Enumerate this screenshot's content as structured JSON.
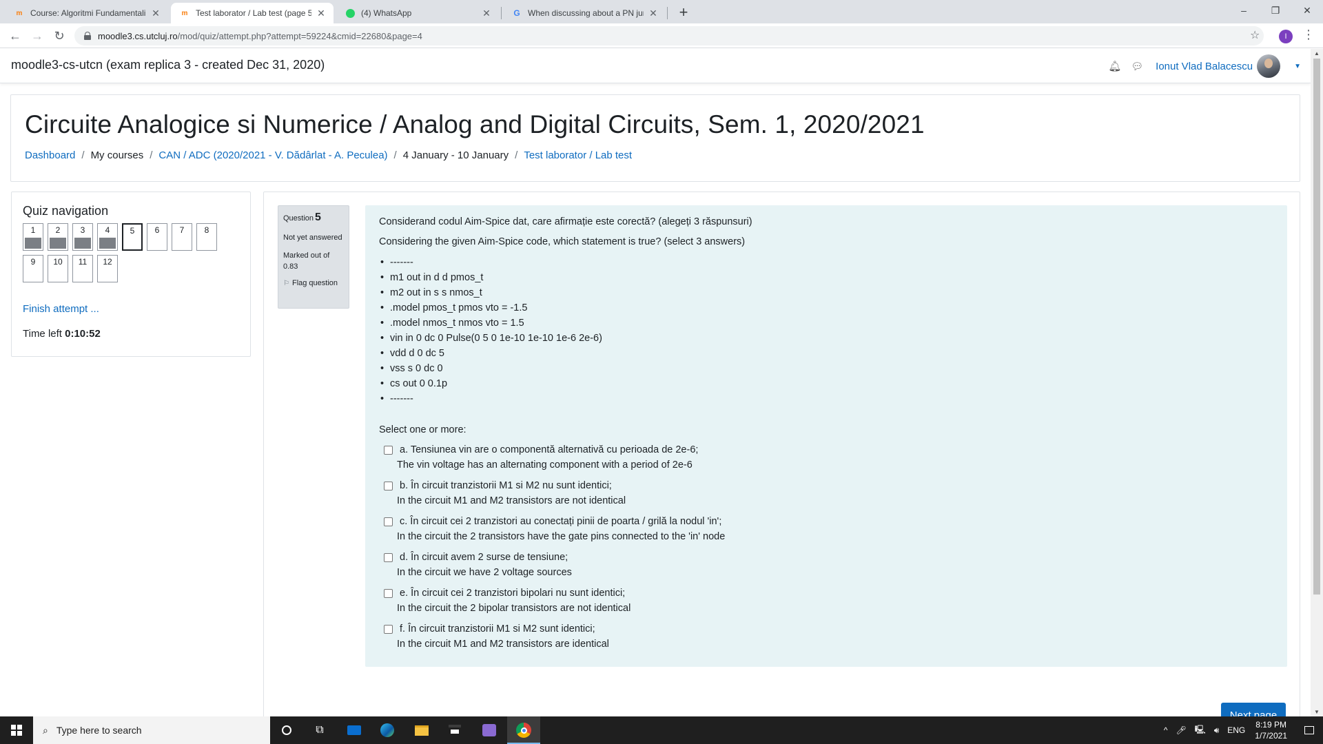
{
  "browser": {
    "tabs": [
      {
        "title": "Course: Algoritmi Fundamentali",
        "favicon": "moodle-icon",
        "active": false
      },
      {
        "title": "Test laborator / Lab test (page 5",
        "favicon": "moodle-icon",
        "active": true
      },
      {
        "title": "(4) WhatsApp",
        "favicon": "whatsapp-icon",
        "active": false
      },
      {
        "title": "When discussing about a PN junc",
        "favicon": "google-icon",
        "active": false
      }
    ],
    "url_host": "moodle3.cs.utcluj.ro",
    "url_path": "/mod/quiz/attempt.php?attempt=59224&cmid=22680&page=4",
    "profile_initial": "I"
  },
  "navbar": {
    "site_name": "moodle3-cs-utcn (exam replica 3 - created Dec 31, 2020)",
    "user_name": "Ionut Vlad Balacescu"
  },
  "header": {
    "course_title": "Circuite Analogice si Numerice / Analog and Digital Circuits, Sem. 1, 2020/2021",
    "breadcrumb": [
      {
        "label": "Dashboard",
        "link": true
      },
      {
        "label": "My courses",
        "link": false
      },
      {
        "label": "CAN / ADC (2020/2021 - V. Dădârlat - A. Peculea)",
        "link": true
      },
      {
        "label": "4 January - 10 January",
        "link": false
      },
      {
        "label": "Test laborator / Lab test",
        "link": true
      }
    ]
  },
  "quiz_nav": {
    "title": "Quiz navigation",
    "questions": [
      {
        "n": "1",
        "answered": true
      },
      {
        "n": "2",
        "answered": true
      },
      {
        "n": "3",
        "answered": true
      },
      {
        "n": "4",
        "answered": true
      },
      {
        "n": "5",
        "answered": false,
        "current": true
      },
      {
        "n": "6",
        "answered": false
      },
      {
        "n": "7",
        "answered": false
      },
      {
        "n": "8",
        "answered": false
      },
      {
        "n": "9",
        "answered": false
      },
      {
        "n": "10",
        "answered": false
      },
      {
        "n": "11",
        "answered": false
      },
      {
        "n": "12",
        "answered": false
      }
    ],
    "finish_label": "Finish attempt ...",
    "time_left_label": "Time left",
    "time_left_value": "0:10:52"
  },
  "question": {
    "label": "Question",
    "number": "5",
    "state": "Not yet answered",
    "grade": "Marked out of 0.83",
    "flag_label": "Flag question",
    "text_ro": "Considerand codul Aim-Spice dat, care afirmație este corectă? (alegeți 3 răspunsuri)",
    "text_en": "Considering the given Aim-Spice code, which statement is true? (select 3 answers)",
    "code_lines": [
      "-------",
      "m1 out in d d pmos_t",
      "m2 out in s s nmos_t",
      ".model pmos_t pmos vto = -1.5",
      ".model nmos_t nmos vto = 1.5",
      "vin in 0 dc 0 Pulse(0 5 0 1e-10 1e-10 1e-6 2e-6)",
      "vdd d 0 dc 5",
      "vss s 0 dc 0",
      "cs out 0 0.1p",
      "-------"
    ],
    "prompt": "Select one or more:",
    "options": [
      {
        "ro": "a. Tensiunea vin are o componentă alternativă cu perioada de 2e-6;",
        "en": "The vin voltage has an alternating component with a period of 2e-6"
      },
      {
        "ro": "b. În circuit tranzistorii M1 si M2 nu sunt identici;",
        "en": "In the circuit M1 and M2 transistors are not identical"
      },
      {
        "ro": "c. În circuit cei 2 tranzistori au conectați pinii de poarta / grilă la nodul 'in';",
        "en": "In the circuit the 2 transistors have the gate pins connected to the 'in' node"
      },
      {
        "ro": "d. În circuit avem 2 surse de tensiune;",
        "en": "In the circuit we have 2 voltage sources"
      },
      {
        "ro": "e. În circuit cei 2 tranzistori bipolari nu sunt identici;",
        "en": "In the circuit the 2 bipolar transistors are not identical"
      },
      {
        "ro": "f. În circuit tranzistorii M1 si M2 sunt identici;",
        "en": "In the circuit M1 and M2 transistors are identical"
      }
    ],
    "next_label": "Next page"
  },
  "taskbar": {
    "search_placeholder": "Type here to search",
    "lang": "ENG",
    "time": "8:19 PM",
    "date": "1/7/2021"
  },
  "colors": {
    "link": "#0f6cbf",
    "question_bg": "#e7f3f5",
    "info_bg": "#dee2e6"
  }
}
